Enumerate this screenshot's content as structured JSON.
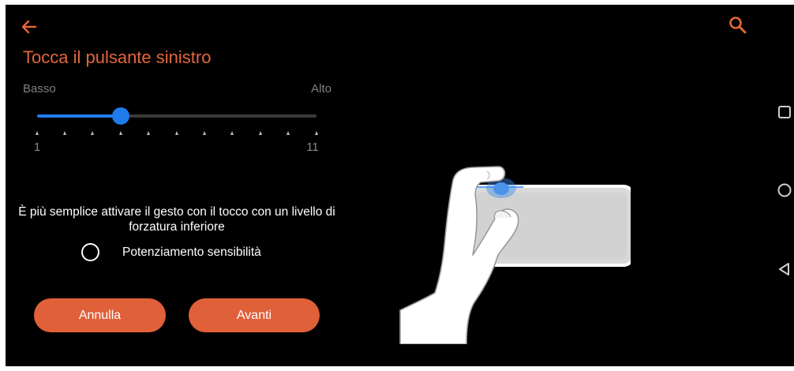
{
  "header": {
    "back_icon": "arrow-left-icon",
    "search_icon": "search-icon",
    "title": "Tocca il pulsante sinistro"
  },
  "slider": {
    "label_low": "Basso",
    "label_high": "Alto",
    "min": 1,
    "max": 11,
    "value": 4,
    "min_label": "1",
    "max_label": "11"
  },
  "hint": {
    "text": "È più semplice attivare il gesto con il tocco con un livello di forzatura inferiore"
  },
  "option": {
    "label": "Potenziamento sensibilità",
    "checked": false
  },
  "actions": {
    "cancel_label": "Annulla",
    "next_label": "Avanti"
  },
  "nav_bar": {
    "recent_icon": "square-icon",
    "home_icon": "circle-icon",
    "back_icon": "triangle-back-icon"
  },
  "colors": {
    "accent": "#e3663a",
    "button": "#e0603a",
    "slider": "#1f7bea",
    "background": "#000000"
  }
}
